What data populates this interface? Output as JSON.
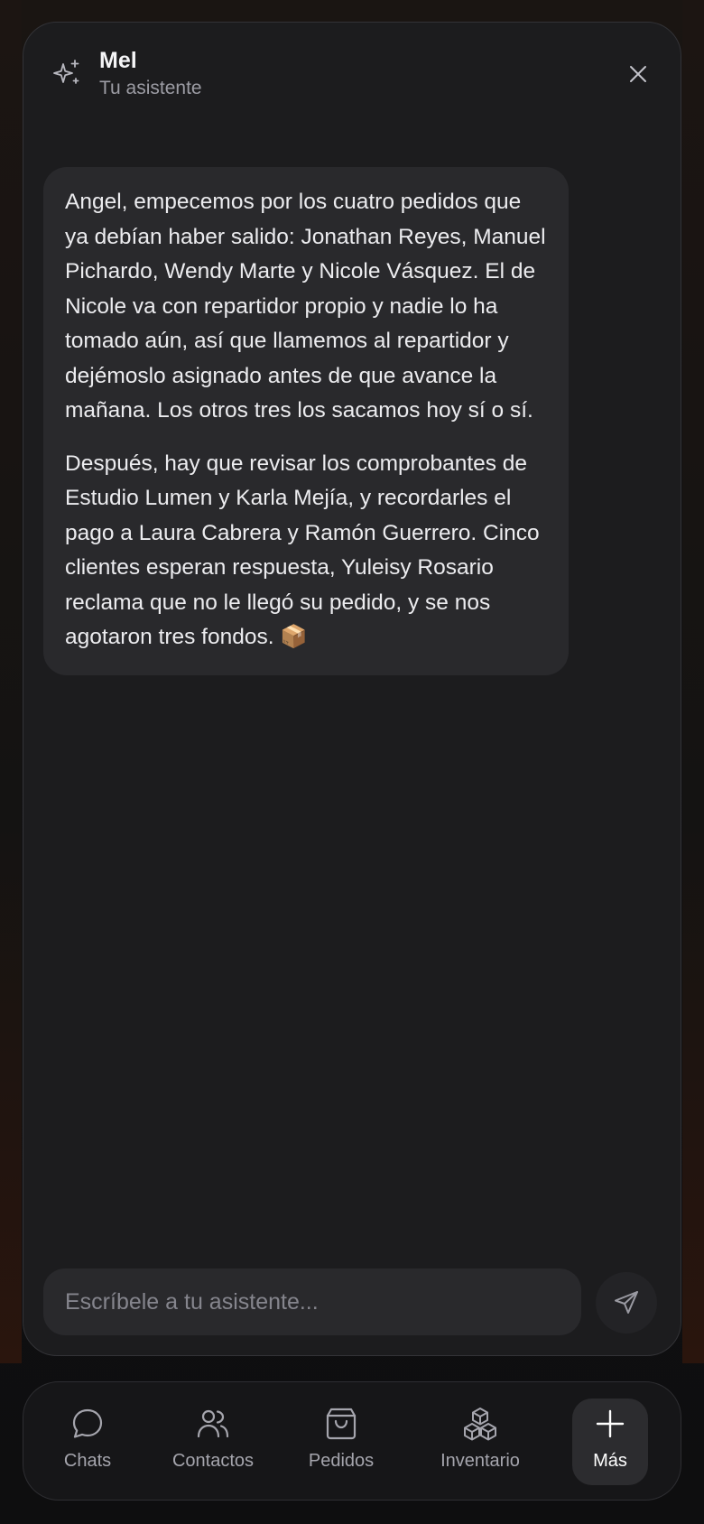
{
  "assistant": {
    "name": "Mel",
    "subtitle": "Tu asistente"
  },
  "icons": {
    "header": "sparkle-icon",
    "close": "close-icon",
    "send": "send-icon"
  },
  "messages": [
    {
      "role": "assistant",
      "paragraphs": [
        "Angel, empecemos por los cuatro pedidos que ya debían haber salido: Jonathan Reyes, Manuel Pichardo, Wendy Marte y Nicole Vásquez. El de Nicole va con repartidor propio y nadie lo ha tomado aún, así que llamemos al repartidor y dejémoslo asignado antes de que avance la mañana. Los otros tres los sacamos hoy sí o sí.",
        "Después, hay que revisar los comprobantes de Estudio Lumen y Karla Mejía, y recordarles el pago a Laura Cabrera y Ramón Guerrero. Cinco clientes esperan respuesta, Yuleisy Rosario reclama que no le llegó su pedido, y se nos agotaron tres fondos. 📦"
      ]
    }
  ],
  "composer": {
    "placeholder": "Escríbele a tu asistente...",
    "value": ""
  },
  "nav": {
    "items": [
      {
        "label": "Chats",
        "icon": "chat-bubble-icon",
        "active": false
      },
      {
        "label": "Contactos",
        "icon": "users-icon",
        "active": false
      },
      {
        "label": "Pedidos",
        "icon": "shopping-bag-icon",
        "active": false
      },
      {
        "label": "Inventario",
        "icon": "boxes-icon",
        "active": false
      },
      {
        "label": "Más",
        "icon": "plus-icon",
        "active": true
      }
    ]
  },
  "colors": {
    "panel": "#1c1c1e",
    "bubble": "#29292c",
    "text": "#ececef",
    "muted": "#9c9ca4"
  }
}
